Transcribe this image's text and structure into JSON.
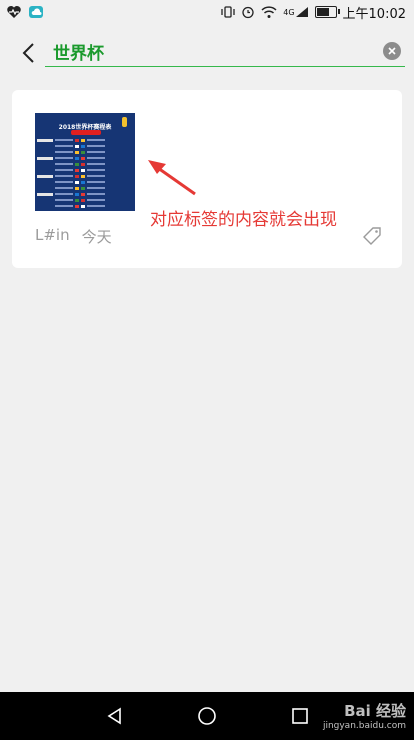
{
  "status_bar": {
    "time": "上午10:02",
    "network": "4G",
    "icons": [
      "health-icon",
      "cloud-icon",
      "vibrate-icon",
      "alarm-icon",
      "wifi-icon",
      "signal-icon",
      "battery-icon"
    ]
  },
  "search": {
    "query": "世界杯",
    "back_icon": "chevron-left-icon",
    "clear_icon": "close-circle-icon"
  },
  "result": {
    "thumbnail_title": "2018世界杯赛程表",
    "source": "L#in",
    "date": "今天",
    "tag_icon": "tag-icon"
  },
  "annotation": {
    "text": "对应标签的内容就会出现",
    "color": "#e53935"
  },
  "nav_bar": {
    "buttons": [
      "back-triangle-icon",
      "home-circle-icon",
      "recent-square-icon"
    ],
    "watermark_title": "Bai 经验",
    "watermark_url": "jingyan.baidu.com"
  },
  "colors": {
    "accent": "#35b84b",
    "query_text": "#1b9a2d",
    "annotation": "#e53935",
    "background": "#f0f0f0"
  }
}
